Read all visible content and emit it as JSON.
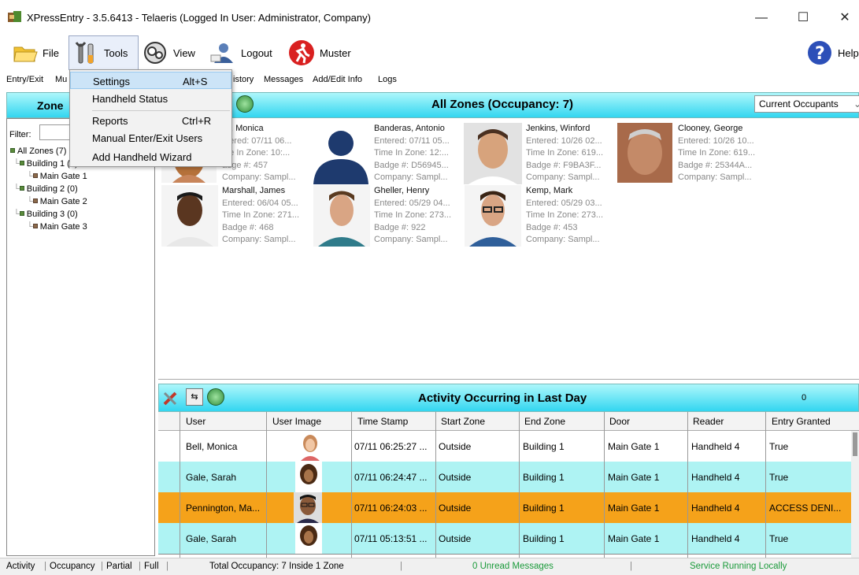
{
  "window": {
    "title": "XPressEntry - 3.5.6413 - Telaeris (Logged In User: Administrator, Company)",
    "minimize": "—",
    "maximize": "☐",
    "close": "✕"
  },
  "toolbar": {
    "file": "File",
    "tools": "Tools",
    "view": "View",
    "logout": "Logout",
    "muster": "Muster",
    "help": "Help"
  },
  "tabs": {
    "entry_exit": "Entry/Exit",
    "mu": "Mu",
    "history": "istory",
    "messages": "Messages",
    "add_edit": "Add/Edit Info",
    "logs": "Logs"
  },
  "tools_menu": {
    "items": [
      {
        "label": "Settings",
        "shortcut": "Alt+S"
      },
      {
        "label": "Handheld Status",
        "shortcut": ""
      },
      {
        "label": "Reports",
        "shortcut": "Ctrl+R"
      },
      {
        "label": "Manual Enter/Exit Users",
        "shortcut": ""
      },
      {
        "label": "Add Handheld Wizard",
        "shortcut": ""
      }
    ]
  },
  "left": {
    "header": "Zone",
    "filter_label": "Filter:",
    "tree": [
      {
        "label": "All Zones (7)"
      },
      {
        "label": "Building 1 (7)"
      },
      {
        "label": "Main Gate 1"
      },
      {
        "label": "Building 2 (0)"
      },
      {
        "label": "Main Gate 2"
      },
      {
        "label": "Building 3 (0)"
      },
      {
        "label": "Main Gate 3"
      }
    ]
  },
  "zones": {
    "title": "All Zones (Occupancy: 7)",
    "view_select": "Current Occupants",
    "cards": [
      {
        "name": "ell, Monica",
        "entered": "ntered: 07/11 06...",
        "time": "me In Zone: 10:...",
        "badge": "adge #: 457",
        "company": "Company: Sampl..."
      },
      {
        "name": "Banderas, Antonio",
        "entered": "Entered: 07/11 05...",
        "time": "Time In Zone: 12:...",
        "badge": "Badge #: D56945...",
        "company": "Company: Sampl..."
      },
      {
        "name": "Jenkins, Winford",
        "entered": "Entered: 10/26 02...",
        "time": "Time In Zone: 619...",
        "badge": "Badge #: F9BA3F...",
        "company": "Company: Sampl..."
      },
      {
        "name": "Clooney, George",
        "entered": "Entered: 10/26 10...",
        "time": "Time In Zone: 619...",
        "badge": "Badge #: 25344A...",
        "company": "Company: Sampl..."
      },
      {
        "name": "Marshall, James",
        "entered": "Entered: 06/04 05...",
        "time": "Time In Zone: 271...",
        "badge": "Badge #: 468",
        "company": "Company: Sampl..."
      },
      {
        "name": "Gheller, Henry",
        "entered": "Entered: 05/29 04...",
        "time": "Time In Zone: 273...",
        "badge": "Badge #: 922",
        "company": "Company: Sampl..."
      },
      {
        "name": "Kemp, Mark",
        "entered": "Entered: 05/29 03...",
        "time": "Time In Zone: 273...",
        "badge": "Badge #: 453",
        "company": "Company: Sampl..."
      }
    ]
  },
  "activity": {
    "title": "Activity Occurring in Last Day",
    "count": "0",
    "columns": [
      "User",
      "User Image",
      "Time Stamp",
      "Start Zone",
      "End Zone",
      "Door",
      "Reader",
      "Entry Granted"
    ],
    "rows": [
      {
        "user": "Bell, Monica",
        "time": "07/11 06:25:27 ...",
        "start": "Outside",
        "end": "Building 1",
        "door": "Main Gate 1",
        "reader": "Handheld 4",
        "granted": "True"
      },
      {
        "user": "Gale, Sarah",
        "time": "07/11 06:24:47 ...",
        "start": "Outside",
        "end": "Building 1",
        "door": "Main Gate 1",
        "reader": "Handheld 4",
        "granted": "True"
      },
      {
        "user": "Pennington, Ma...",
        "time": "07/11 06:24:03 ...",
        "start": "Outside",
        "end": "Building 1",
        "door": "Main Gate 1",
        "reader": "Handheld 4",
        "granted": "ACCESS DENI..."
      },
      {
        "user": "Gale, Sarah",
        "time": "07/11 05:13:51 ...",
        "start": "Outside",
        "end": "Building 1",
        "door": "Main Gate 1",
        "reader": "Handheld 4",
        "granted": "True"
      }
    ]
  },
  "status": {
    "tabs": [
      "Activity",
      "Occupancy",
      "Partial",
      "Full"
    ],
    "total": "Total Occupancy: 7 Inside 1 Zone",
    "messages": "0 Unread Messages",
    "service": "Service Running Locally"
  },
  "colors": {
    "header_cyan": "#33d6f0",
    "row_white": "#ffffff",
    "row_cyan": "#aef3f3",
    "row_denied": "#f5a21a",
    "status_green": "#1a9a3a"
  }
}
